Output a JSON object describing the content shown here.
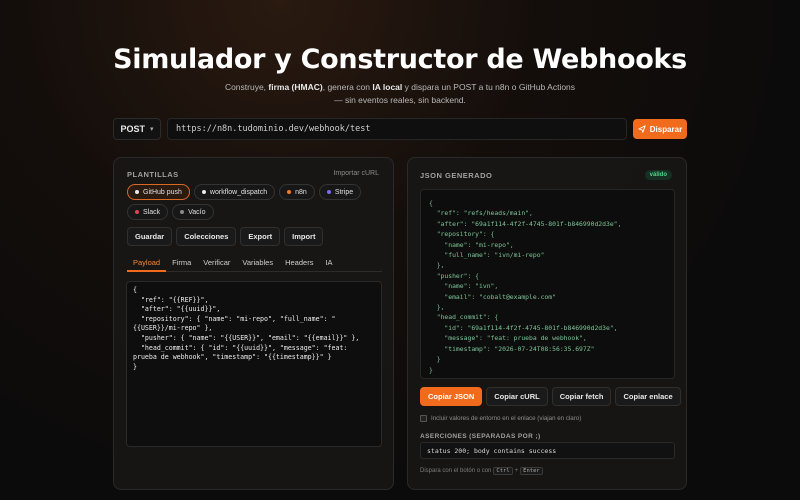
{
  "header": {
    "title": "Simulador y Constructor de Webhooks",
    "subtitle_pre": "Construye, ",
    "subtitle_b1": "firma (HMAC)",
    "subtitle_mid1": ", genera con ",
    "subtitle_b2": "IA local",
    "subtitle_post": " y dispara un POST a tu n8n o GitHub Actions — sin eventos reales, sin backend."
  },
  "request": {
    "method": "POST",
    "url": "https://n8n.tudominio.dev/webhook/test",
    "send_label": "Disparar"
  },
  "left_panel": {
    "title": "PLANTILLAS",
    "import_link": "Importar cURL",
    "templates": [
      {
        "label": "GitHub push",
        "color": "#e8e8e8",
        "active": true
      },
      {
        "label": "workflow_dispatch",
        "color": "#e8e8e8",
        "active": false
      },
      {
        "label": "n8n",
        "color": "#f07a2b",
        "active": false
      },
      {
        "label": "Stripe",
        "color": "#7c6cf0",
        "active": false
      },
      {
        "label": "Slack",
        "color": "#e0405a",
        "active": false
      },
      {
        "label": "Vacío",
        "color": "#888888",
        "active": false
      }
    ],
    "actions": [
      "Guardar",
      "Colecciones",
      "Export",
      "Import"
    ],
    "tabs": [
      "Payload",
      "Firma",
      "Verificar",
      "Variables",
      "Headers",
      "IA"
    ],
    "payload": "{\n  \"ref\": \"{{REF}}\",\n  \"after\": \"{{uuid}}\",\n  \"repository\": { \"name\": \"mi-repo\", \"full_name\": \"{{USER}}/mi-repo\" },\n  \"pusher\": { \"name\": \"{{USER}}\", \"email\": \"{{email}}\" },\n  \"head_commit\": { \"id\": \"{{uuid}}\", \"message\": \"feat: prueba de webhook\", \"timestamp\": \"{{timestamp}}\" }\n}"
  },
  "right_panel": {
    "title": "JSON GENERADO",
    "badge": "válido",
    "json": "{\n  \"ref\": \"refs/heads/main\",\n  \"after\": \"69a1f114-4f2f-4745-801f-b846990d2d3e\",\n  \"repository\": {\n    \"name\": \"mi-repo\",\n    \"full_name\": \"ivn/mi-repo\"\n  },\n  \"pusher\": {\n    \"name\": \"ivn\",\n    \"email\": \"cobalt@example.com\"\n  },\n  \"head_commit\": {\n    \"id\": \"69a1f114-4f2f-4745-801f-b846990d2d3e\",\n    \"message\": \"feat: prueba de webhook\",\n    \"timestamp\": \"2026-07-24T08:56:35.697Z\"\n  }\n}",
    "copy_buttons": [
      "Copiar JSON",
      "Copiar cURL",
      "Copiar fetch",
      "Copiar enlace"
    ],
    "env_checkbox_label": "Incluir valores de entorno en el enlace (viajan en claro)",
    "assertions_label": "ASERCIONES (SEPARADAS POR ;)",
    "assertions_value": "status 200; body contains success",
    "hint_pre": "Dispara con el botón o con",
    "hint_key1": "Ctrl",
    "hint_plus": "+",
    "hint_key2": "Enter"
  }
}
